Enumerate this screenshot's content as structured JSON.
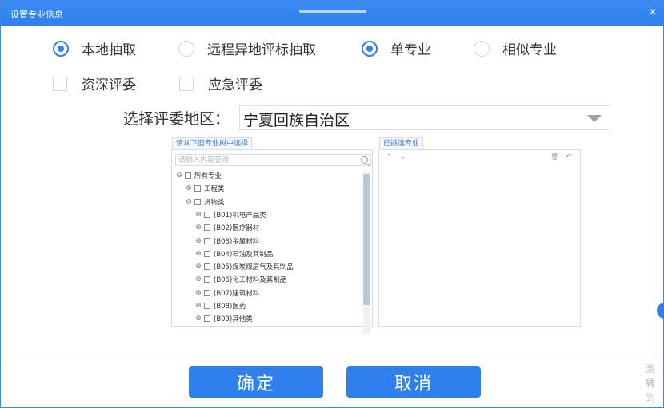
{
  "window": {
    "title": "设置专业信息",
    "close_icon": "close-icon"
  },
  "options": {
    "extraction_mode": [
      {
        "label": "本地抽取",
        "selected": true
      },
      {
        "label": "远程异地评标抽取",
        "selected": false
      }
    ],
    "specialty_mode": [
      {
        "label": "单专业",
        "selected": true
      },
      {
        "label": "相似专业",
        "selected": false
      }
    ],
    "reviewer_type": [
      {
        "label": "资深评委",
        "checked": false
      },
      {
        "label": "应急评委",
        "checked": false
      }
    ]
  },
  "region": {
    "label": "选择评委地区：",
    "value": "宁夏回族自治区"
  },
  "left_panel": {
    "title": "请从下面专业树中选择",
    "search_placeholder": "请输入内容查询",
    "tree": [
      {
        "label": "所有专业",
        "level": 0,
        "expander": "⊖"
      },
      {
        "label": "工程类",
        "level": 1,
        "expander": "⊕"
      },
      {
        "label": "货物类",
        "level": 1,
        "expander": "⊖"
      },
      {
        "label": "(B01)机电产品类",
        "level": 2,
        "expander": "⊕"
      },
      {
        "label": "(B02)医疗器材",
        "level": 2,
        "expander": "⊕"
      },
      {
        "label": "(B03)金属材料",
        "level": 2,
        "expander": "⊕"
      },
      {
        "label": "(B04)石油及其制品",
        "level": 2,
        "expander": "⊕"
      },
      {
        "label": "(B05)煤炭煤层气及其制品",
        "level": 2,
        "expander": "⊕"
      },
      {
        "label": "(B06)化工材料及其制品",
        "level": 2,
        "expander": "⊕"
      },
      {
        "label": "(B07)建筑材料",
        "level": 2,
        "expander": "⊕"
      },
      {
        "label": "(B08)医药",
        "level": 2,
        "expander": "⊕"
      },
      {
        "label": "(B09)其他类",
        "level": 2,
        "expander": "⊕"
      }
    ]
  },
  "right_panel": {
    "title": "已挑选专业",
    "tools": {
      "up": "⌃",
      "down": "⌄",
      "delete": "🗑",
      "undo": "↶"
    }
  },
  "buttons": {
    "confirm": "确定",
    "cancel": "取消"
  },
  "watermark": {
    "line1": "激活",
    "line2": "转到"
  },
  "colors": {
    "accent": "#2f7fed",
    "titlebar": "#3c8cf5"
  }
}
